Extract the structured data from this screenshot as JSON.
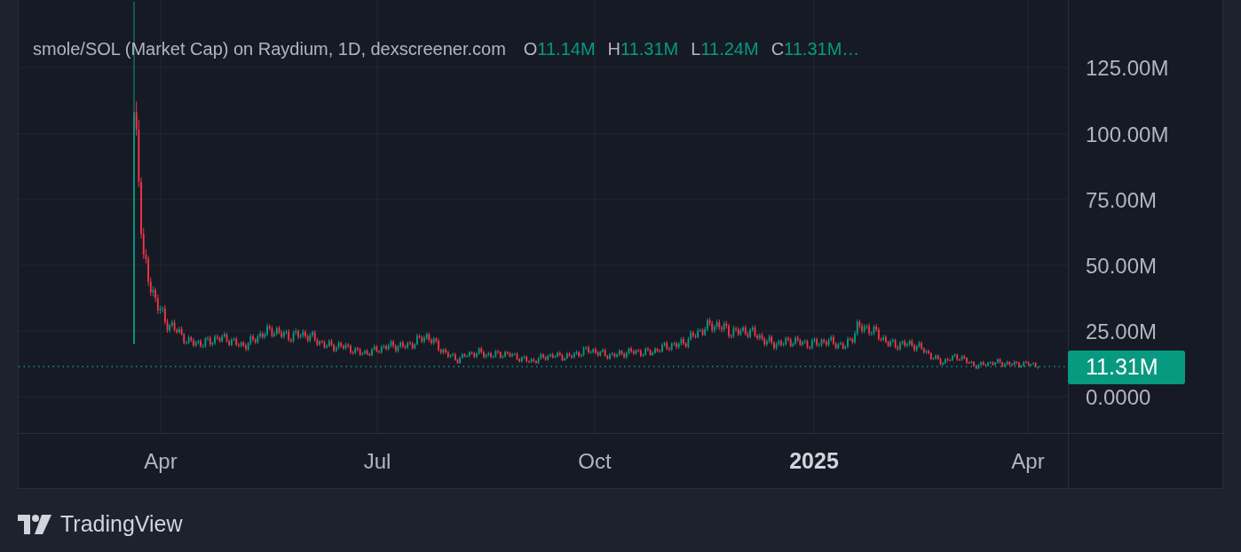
{
  "legend": {
    "title": "smole/SOL (Market Cap) on Raydium, 1D, dexscreener.com",
    "items": [
      {
        "label": "O",
        "value": "11.14M"
      },
      {
        "label": "H",
        "value": "11.31M"
      },
      {
        "label": "L",
        "value": "11.24M"
      },
      {
        "label": "C",
        "value": "11.31M…"
      }
    ]
  },
  "price_axis": {
    "labels": [
      "125.00M",
      "100.00M",
      "75.00M",
      "50.00M",
      "25.00M",
      "0.0000"
    ]
  },
  "last_price": {
    "text": "11.31M"
  },
  "time_axis": {
    "labels": [
      {
        "text": "Apr",
        "bold": false
      },
      {
        "text": "Jul",
        "bold": false
      },
      {
        "text": "Oct",
        "bold": false
      },
      {
        "text": "2025",
        "bold": true
      },
      {
        "text": "Apr",
        "bold": false
      }
    ]
  },
  "footer": {
    "brand": "TradingView"
  }
}
